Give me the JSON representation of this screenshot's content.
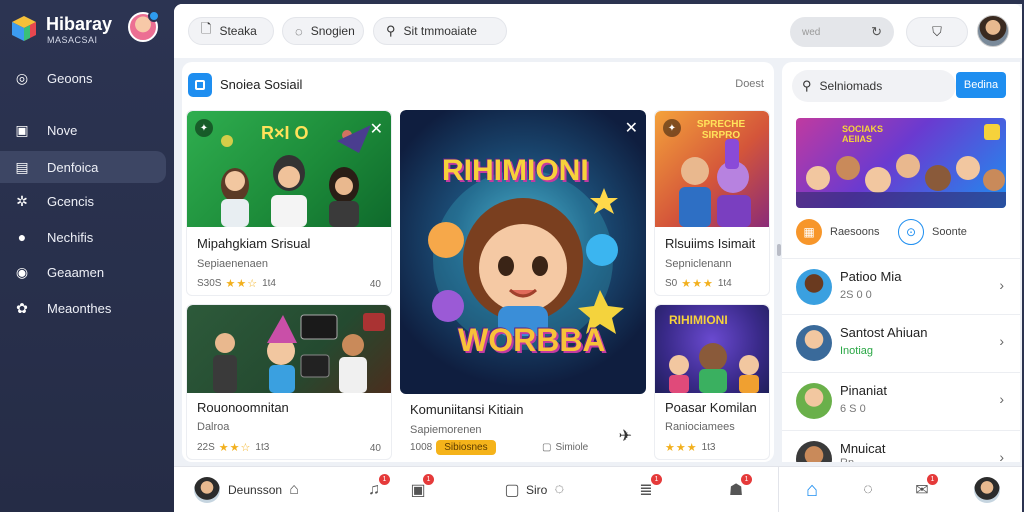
{
  "brand": {
    "name": "Hibaray",
    "subtitle": "MASACSAI"
  },
  "sidebar": {
    "items": [
      {
        "label": "Geoons",
        "icon": "globe-icon"
      },
      {
        "label": "Nove",
        "icon": "bookmark-icon"
      },
      {
        "label": "Denfoica",
        "icon": "inbox-icon",
        "active": true
      },
      {
        "label": "Gcencis",
        "icon": "sparkle-icon"
      },
      {
        "label": "Nechifis",
        "icon": "chat-bubble-icon"
      },
      {
        "label": "Geaamen",
        "icon": "gamepad-icon"
      },
      {
        "label": "Meaonthes",
        "icon": "gear-icon"
      }
    ]
  },
  "topbar": {
    "tabs": [
      {
        "label": "Steaka",
        "icon": "document-icon"
      },
      {
        "label": "Snogien",
        "icon": "comment-icon"
      },
      {
        "label": "Sit tmmoaiate",
        "icon": "search-icon"
      }
    ],
    "search_placeholder": "wed"
  },
  "content": {
    "title": "Snoiea Sosiail",
    "more": "Doest",
    "tiles": [
      {
        "title": "Mipahgkiam Srisual",
        "subtitle": "Sepiaenenaen",
        "meta": "S30S",
        "stars": "★★☆",
        "extra": "1t4",
        "count": "40"
      },
      {
        "title": "Rlsuiims Isimait",
        "subtitle": "Sepniclenann",
        "meta": "S0",
        "stars": "★★★",
        "extra": "1t4",
        "count": ""
      },
      {
        "title": "Rouonoomnitan",
        "subtitle": "Dalroa",
        "meta": "22S",
        "stars": "★★☆",
        "extra": "1t3",
        "count": "40"
      },
      {
        "title": "Komuniitansi Kitiain",
        "subtitle": "Sapiemorenen",
        "meta": "1008",
        "tag": "Sibiosnes",
        "extra": "Simiole",
        "count": ""
      },
      {
        "title": "Poasar Komilan",
        "subtitle": "Raniociamees",
        "meta": "",
        "stars": "★★★",
        "extra": "1t3",
        "count": ""
      }
    ],
    "feature_title_top": "RIHIMIONI",
    "feature_title_bottom": "WORBBA",
    "thumb_captions": {
      "tile1": "R×I O",
      "tile2": "SPRECHE SIRPRO",
      "tile5": "RIHIMIONI"
    }
  },
  "right": {
    "search_label": "Selniomads",
    "button_label": "Bedina",
    "hero_caption": "SOCIAKS AEIIAS",
    "chips": [
      {
        "label": "Raesoons",
        "icon": "calendar-icon"
      },
      {
        "label": "Soonte",
        "icon": "lock-icon"
      }
    ],
    "friends": [
      {
        "name": "Patioo Mia",
        "status": "2S 0 0",
        "green": false
      },
      {
        "name": "Santost Ahiuan",
        "status": "Inotiag",
        "green": true
      },
      {
        "name": "Pinaniat",
        "status": "6 S 0",
        "green": false
      },
      {
        "name": "Mnuicat",
        "status": "Rn",
        "green": false
      }
    ]
  },
  "bottombar": {
    "profile_label": "Deunsson",
    "middle_label": "Siro",
    "badges": [
      "1",
      "1",
      "1",
      "1",
      "1"
    ]
  },
  "colors": {
    "accent": "#1e8ef0",
    "sidebar": "#2c3452",
    "star": "#f2b01e",
    "badge": "#e53a3a",
    "tag": "#f5b31a"
  }
}
